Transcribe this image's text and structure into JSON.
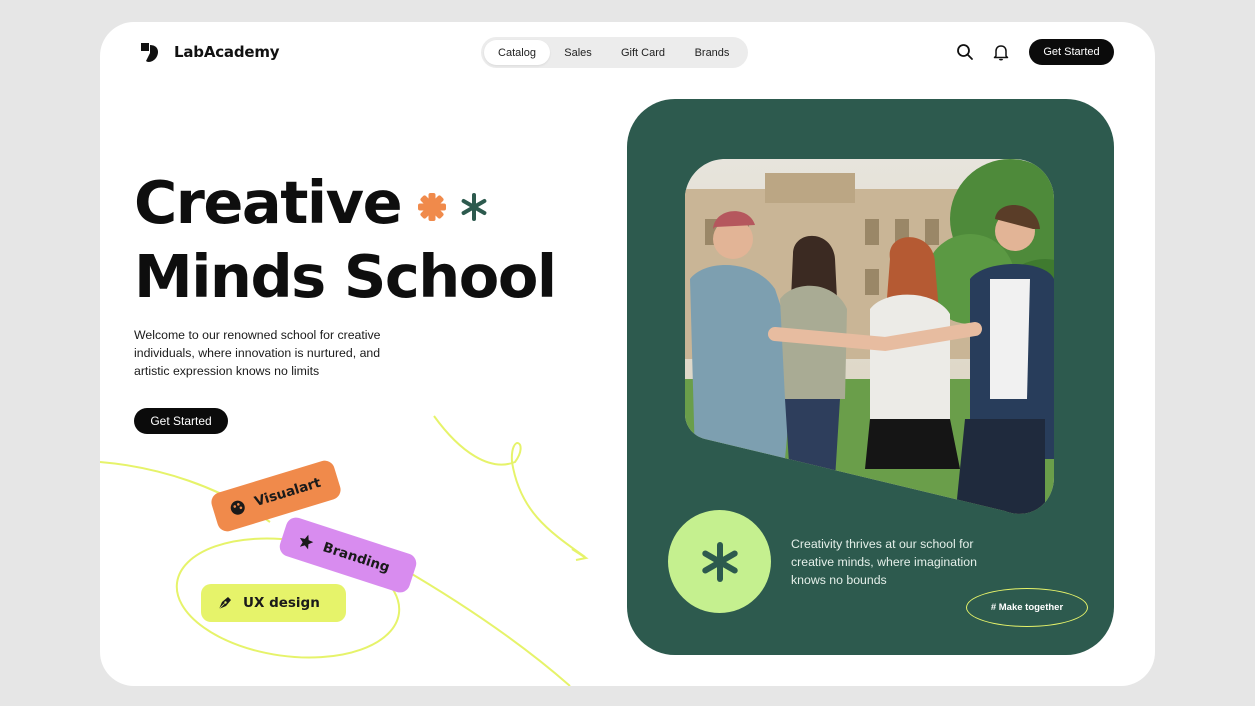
{
  "brand": {
    "name": "LabAcademy",
    "icon": "labacademy-logo-icon"
  },
  "nav": {
    "items": [
      {
        "label": "Catalog",
        "active": true
      },
      {
        "label": "Sales",
        "active": false
      },
      {
        "label": "Gift Card",
        "active": false
      },
      {
        "label": "Brands",
        "active": false
      }
    ]
  },
  "header": {
    "search_icon": "search-icon",
    "bell_icon": "bell-icon",
    "cta_label": "Get Started"
  },
  "hero": {
    "title_line1": "Creative",
    "title_line2": "Minds School",
    "description": "Welcome to our renowned school for creative individuals, where innovation is nurtured, and artistic expression knows no limits",
    "cta_label": "Get Started"
  },
  "tags": [
    {
      "label": "Visualart",
      "color": "#f08a4b",
      "icon": "palette-icon"
    },
    {
      "label": "Branding",
      "color": "#d88cef",
      "icon": "star-icon"
    },
    {
      "label": "UX design",
      "color": "#e6f36a",
      "icon": "pen-nib-icon"
    }
  ],
  "feature": {
    "panel_color": "#2d5a4e",
    "badge_color": "#c5f08f",
    "text": "Creativity thrives at our school for creative minds, where imagination knows no bounds",
    "tag_label": "# Make together"
  },
  "colors": {
    "accent_orange": "#f08a4b",
    "accent_green": "#2d5a4e",
    "accent_lime": "#e6f36a",
    "accent_purple": "#d88cef"
  }
}
